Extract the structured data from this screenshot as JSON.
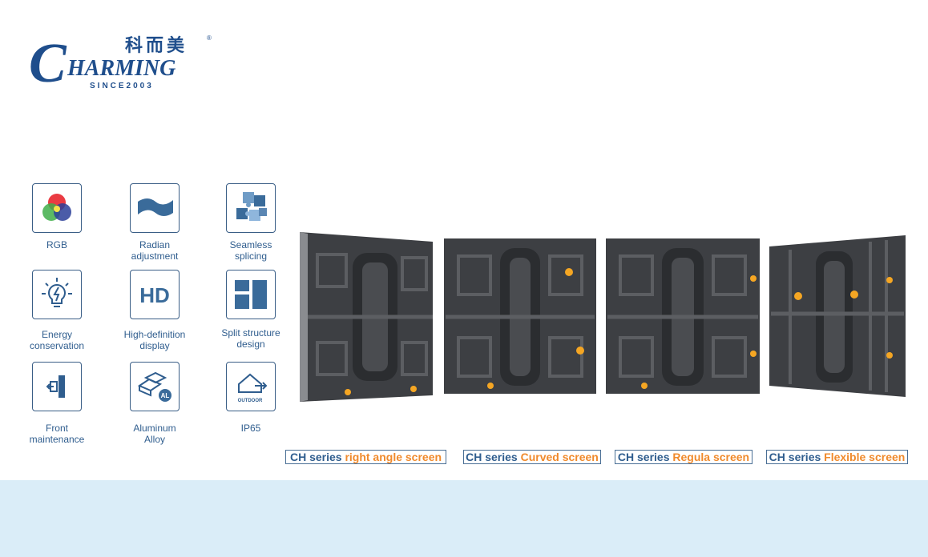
{
  "brand": {
    "chinese": "科而美",
    "name_initial": "C",
    "name_rest": "HARMING",
    "since": "SINCE2003",
    "registered_mark": "®"
  },
  "features": [
    {
      "label": "RGB",
      "icon": "rgb-circles-icon"
    },
    {
      "label": "Radian\nadjustment",
      "icon": "wave-icon"
    },
    {
      "label": "Seamless\nsplicing",
      "icon": "puzzle-icon"
    },
    {
      "label": "Energy\nconservation",
      "icon": "lightbulb-icon"
    },
    {
      "label": "High-definition\ndisplay",
      "icon": "hd-icon"
    },
    {
      "label": "Split structure\ndesign",
      "icon": "split-windows-icon"
    },
    {
      "label": "Front\nmaintenance",
      "icon": "front-maintenance-icon"
    },
    {
      "label": "Aluminum\nAlloy",
      "icon": "aluminum-ingot-icon"
    },
    {
      "label": "IP65",
      "icon": "outdoor-house-icon",
      "icon_text": "OUTDOOR"
    }
  ],
  "products": [
    {
      "prefix": "CH series",
      "name": "right angle screen"
    },
    {
      "prefix": "CH series",
      "name": "Curved screen"
    },
    {
      "prefix": "CH series",
      "name": "Regula screen"
    },
    {
      "prefix": "CH series",
      "name": "Flexible screen"
    }
  ],
  "colors": {
    "brand_blue": "#1f4e8c",
    "label_blue": "#2f5d8e",
    "accent_orange": "#f08a2c",
    "band": "#daedf8",
    "panel_dark": "#3d3f43"
  }
}
